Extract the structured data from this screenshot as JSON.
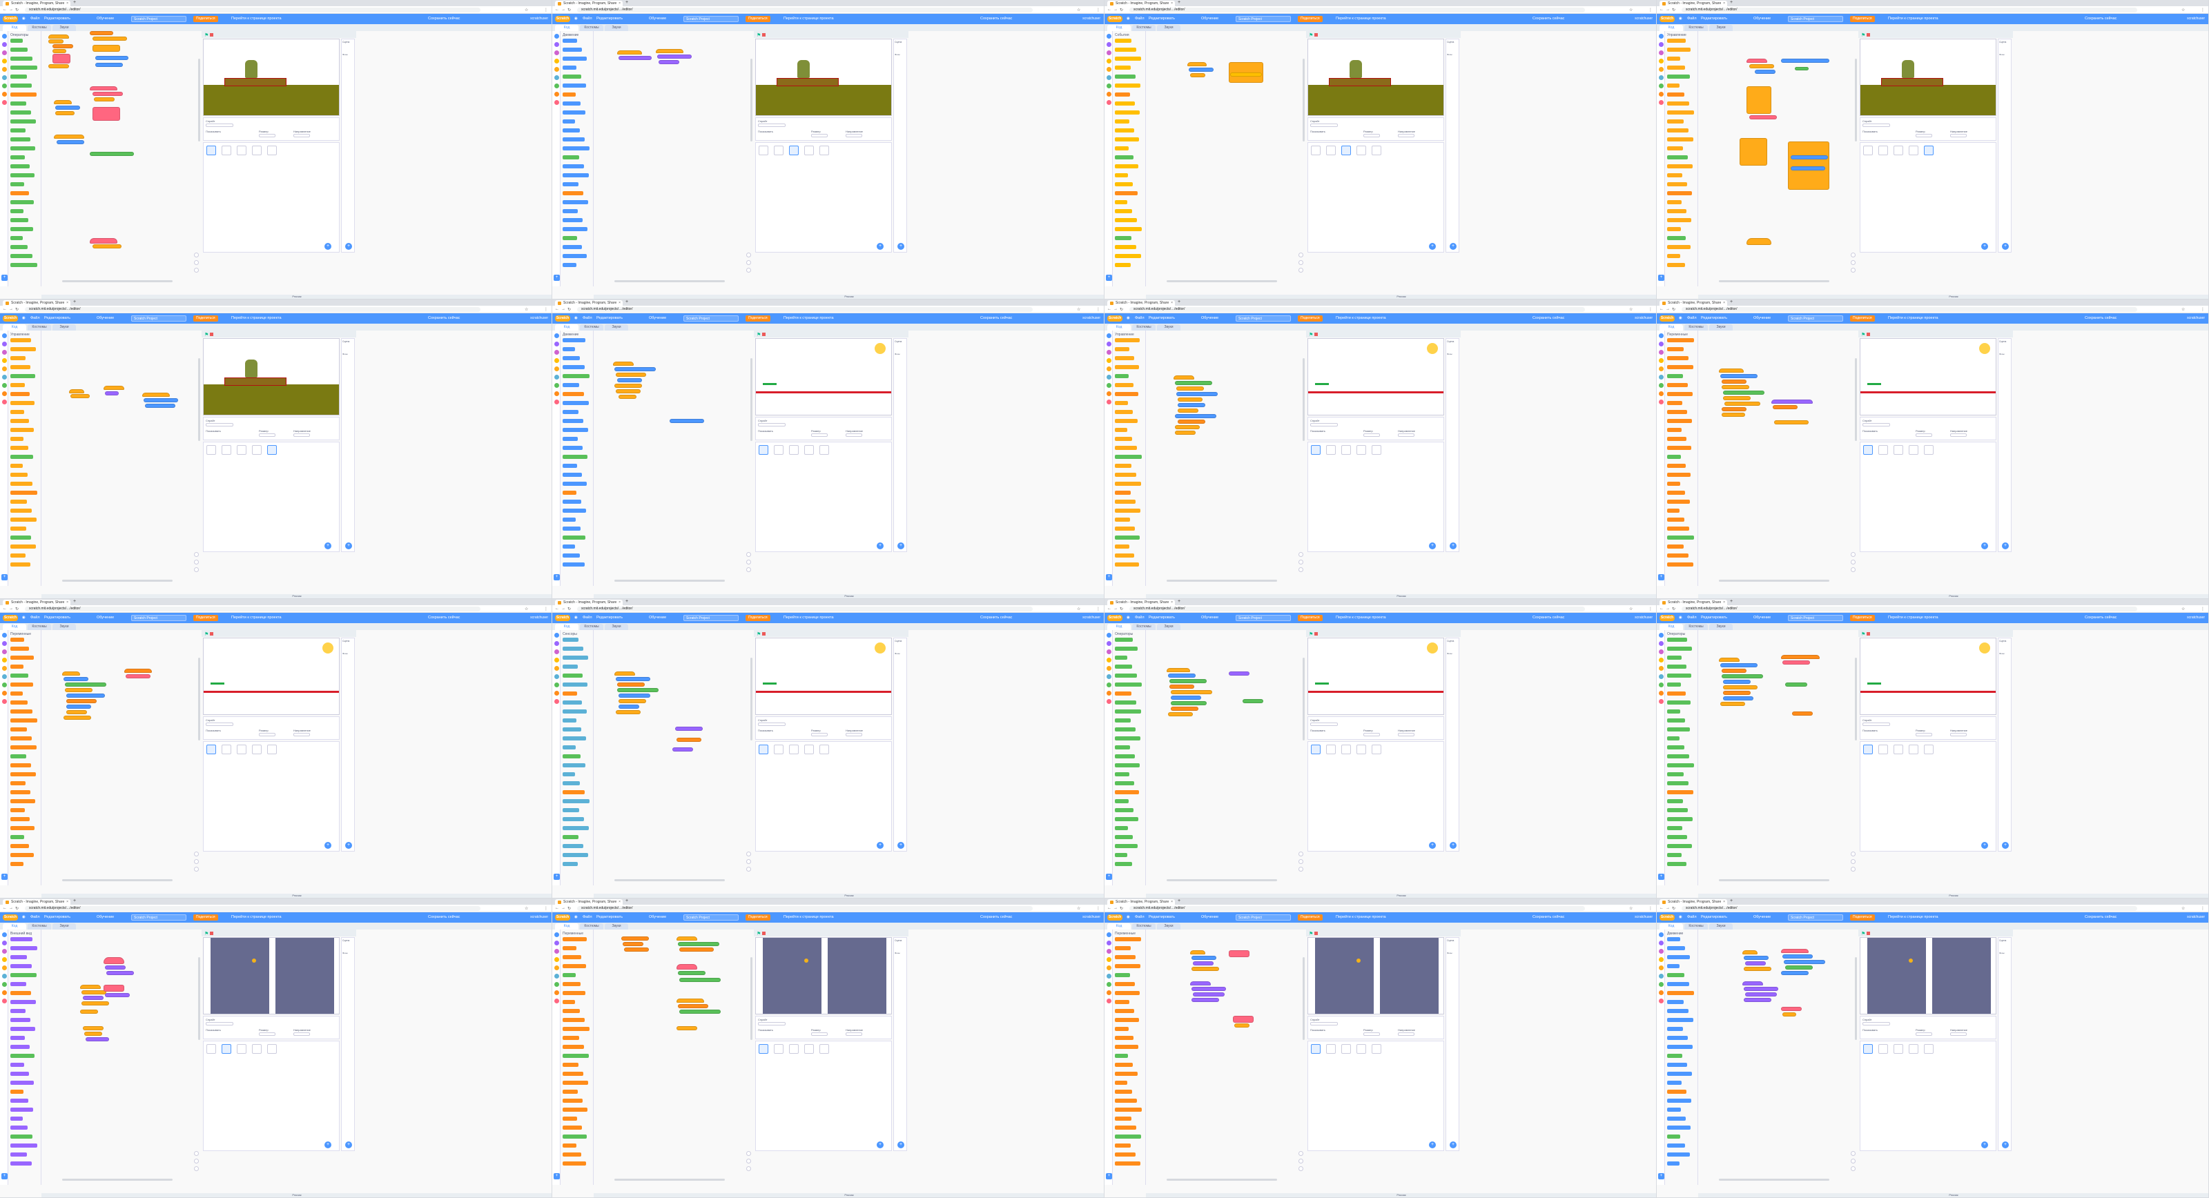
{
  "browser": {
    "tab_title": "Scratch - Imagine, Program, Share",
    "url": "scratch.mit.edu/projects/…/editor/"
  },
  "menubar": {
    "logo": "Scratch",
    "items": [
      "Файл",
      "Редактировать"
    ],
    "tutorials": "Обучение",
    "project_title": "Scratch Project",
    "share": "Поделиться",
    "see_project": "Перейти к странице проекта",
    "save": "Сохранить сейчас",
    "account": "scratchuser"
  },
  "editor_tabs": [
    "Код",
    "Костюмы",
    "Звуки"
  ],
  "categories": [
    {
      "label": "Движение",
      "color": "#4c97ff"
    },
    {
      "label": "Внешний вид",
      "color": "#9966ff"
    },
    {
      "label": "Звук",
      "color": "#cf63cf"
    },
    {
      "label": "События",
      "color": "#ffbf00"
    },
    {
      "label": "Управление",
      "color": "#ffab19"
    },
    {
      "label": "Сенсоры",
      "color": "#5cb1d6"
    },
    {
      "label": "Операторы",
      "color": "#59c059"
    },
    {
      "label": "Переменные",
      "color": "#ff8c1a"
    },
    {
      "label": "Другие блоки",
      "color": "#ff6680"
    }
  ],
  "sprite_info": {
    "sprite": "Спрайт",
    "show": "Показывать",
    "size": "Размер",
    "direction": "Направление",
    "stage": "Сцена",
    "backdrops": "Фоны"
  },
  "backpack": "Рюкзак",
  "tiles": [
    {
      "palette_head": "Операторы"
    },
    {
      "palette_head": "Движение"
    },
    {
      "palette_head": "События"
    },
    {
      "palette_head": "Управление"
    },
    {
      "palette_head": "Управление"
    },
    {
      "palette_head": "Движение"
    },
    {
      "palette_head": "Управление"
    },
    {
      "palette_head": "Переменные"
    },
    {
      "palette_head": "Переменные"
    },
    {
      "palette_head": "Сенсоры"
    },
    {
      "palette_head": "Операторы"
    },
    {
      "palette_head": "Операторы"
    },
    {
      "palette_head": "Внешний вид"
    },
    {
      "palette_head": "Переменные"
    },
    {
      "palette_head": "Переменные"
    },
    {
      "palette_head": "Движение"
    }
  ]
}
